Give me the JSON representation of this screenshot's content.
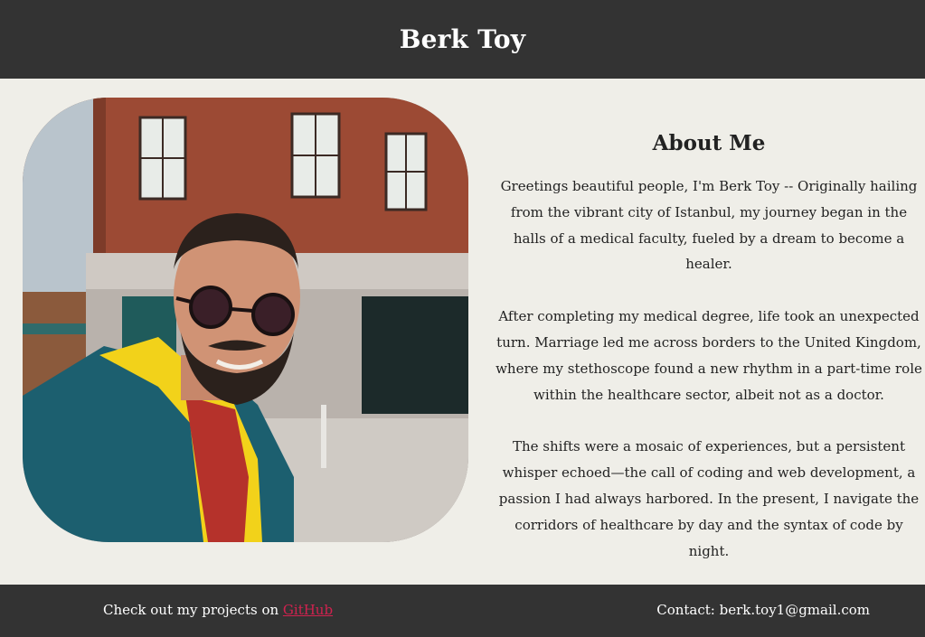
{
  "header": {
    "title": "Berk Toy"
  },
  "photo": {
    "description_icon": "portrait-photo"
  },
  "about": {
    "heading": "About Me",
    "paragraphs": [
      "Greetings beautiful people, I'm Berk Toy -- Originally hailing from the vibrant city of Istanbul, my journey began in the halls of a medical faculty, fueled by a dream to become a healer.",
      "After completing my medical degree, life took an unexpected turn. Marriage led me across borders to the United Kingdom, where my stethoscope found a new rhythm in a part-time role within the healthcare sector, albeit not as a doctor.",
      "The shifts were a mosaic of experiences, but a persistent whisper echoed—the call of coding and web development, a passion I had always harbored. In the present, I navigate the corridors of healthcare by day and the syntax of code by night."
    ]
  },
  "footer": {
    "projects_prefix": "Check out my projects on ",
    "github_label": "GitHub",
    "contact": "Contact: berk.toy1@gmail.com"
  },
  "colors": {
    "bar": "#333333",
    "background": "#efeee8",
    "link": "#d1224f"
  }
}
